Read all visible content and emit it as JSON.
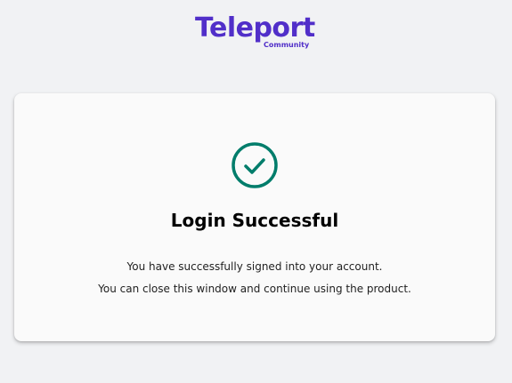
{
  "logo": {
    "wordmark": "Teleport",
    "edition": "Community"
  },
  "card": {
    "icon": "check-circle-icon",
    "title": "Login Successful",
    "messages": [
      "You have successfully signed into your account.",
      "You can close this window and continue using the product."
    ]
  },
  "colors": {
    "brand": "#512fc9",
    "success": "#007d6b",
    "background": "#f1f2f4",
    "card": "#fafafa"
  }
}
